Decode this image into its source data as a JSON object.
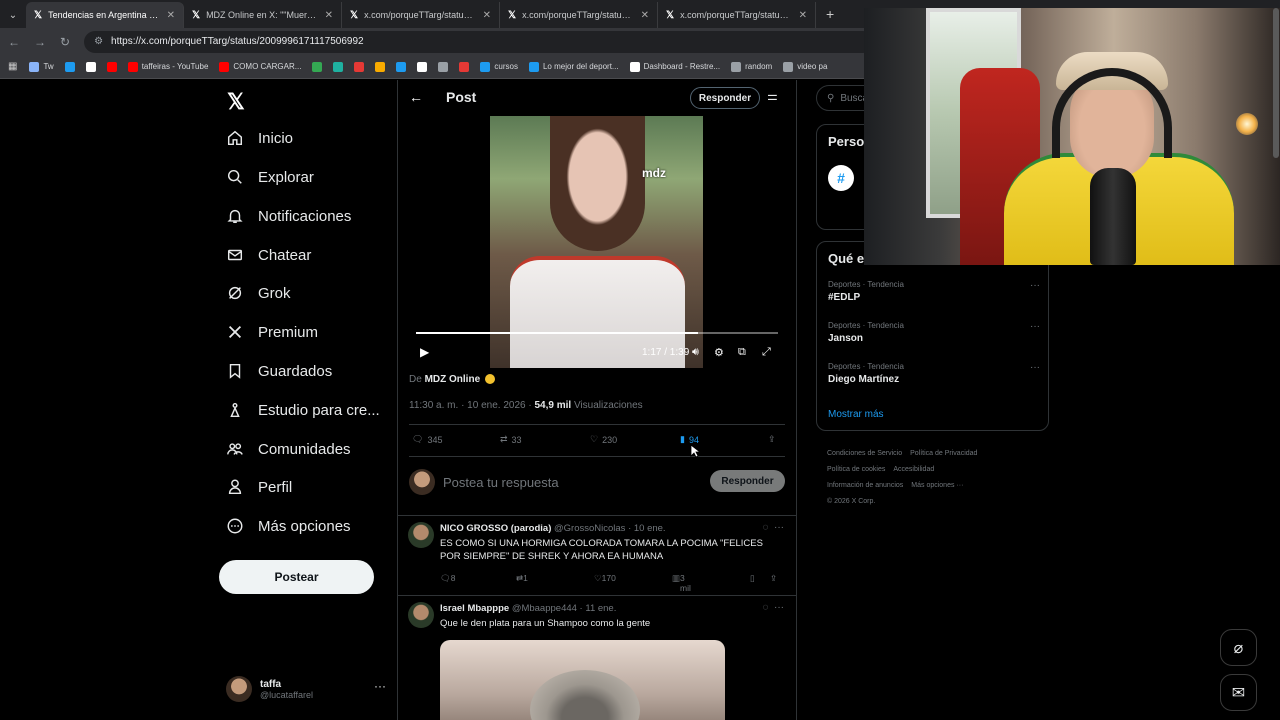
{
  "browser": {
    "tabs": [
      {
        "title": "Tendencias en Argentina en X:",
        "active": true
      },
      {
        "title": "MDZ Online en X: \"\"Muere un",
        "active": false
      },
      {
        "title": "x.com/porqueTTarg/status/200",
        "active": false
      },
      {
        "title": "x.com/porqueTTarg/status/200",
        "active": false
      },
      {
        "title": "x.com/porqueTTarg/status/200",
        "active": false
      }
    ],
    "url": "https://x.com/porqueTTarg/status/2009996171117506992",
    "bookmarks": [
      {
        "label": "Tw",
        "color": "#8ab4f8"
      },
      {
        "label": "",
        "color": "#1d9bf0"
      },
      {
        "label": "",
        "color": "#ffffff"
      },
      {
        "label": "",
        "color": "#ff0000"
      },
      {
        "label": "taffeiras - YouTube",
        "color": "#ff0000"
      },
      {
        "label": "COMO CARGAR...",
        "color": "#ff0000"
      },
      {
        "label": "",
        "color": "#34a853"
      },
      {
        "label": "",
        "color": "#1fb1a0"
      },
      {
        "label": "",
        "color": "#e53935"
      },
      {
        "label": "",
        "color": "#f9ab00"
      },
      {
        "label": "",
        "color": "#1d9bf0"
      },
      {
        "label": "",
        "color": "#ffffff"
      },
      {
        "label": "",
        "color": "#9aa0a6"
      },
      {
        "label": "",
        "color": "#e53935"
      },
      {
        "label": "cursos",
        "color": "#1d9bf0"
      },
      {
        "label": "Lo mejor del deport...",
        "color": "#1d9bf0"
      },
      {
        "label": "Dashboard - Restre...",
        "color": "#ffffff"
      },
      {
        "label": "random",
        "color": "#9aa0a6"
      },
      {
        "label": "video pa",
        "color": "#9aa0a6"
      }
    ]
  },
  "nav": {
    "items": [
      {
        "label": "Inicio",
        "icon": "home-icon"
      },
      {
        "label": "Explorar",
        "icon": "search-icon"
      },
      {
        "label": "Notificaciones",
        "icon": "bell-icon"
      },
      {
        "label": "Chatear",
        "icon": "mail-icon"
      },
      {
        "label": "Grok",
        "icon": "grok-icon"
      },
      {
        "label": "Premium",
        "icon": "x-icon"
      },
      {
        "label": "Guardados",
        "icon": "bookmark-icon"
      },
      {
        "label": "Estudio para cre...",
        "icon": "studio-icon"
      },
      {
        "label": "Comunidades",
        "icon": "communities-icon"
      },
      {
        "label": "Perfil",
        "icon": "person-icon"
      },
      {
        "label": "Más opciones",
        "icon": "more-icon"
      }
    ],
    "post_button": "Postear",
    "account": {
      "name": "taffa",
      "handle": "@lucataffarel"
    }
  },
  "post": {
    "header_title": "Post",
    "reply_button": "Responder",
    "video": {
      "logo": "mdz",
      "time": "1:17 / 1:39",
      "progress": 0.78
    },
    "author_prefix": "De",
    "author": "MDZ Online",
    "timestamp": "11:30 a. m. · 10 ene. 2026 ·",
    "views": "54,9 mil",
    "views_label": "Visualizaciones",
    "stats": {
      "replies": "345",
      "reposts": "33",
      "likes": "230",
      "bookmarks": "94"
    },
    "compose_placeholder": "Postea tu respuesta",
    "compose_button": "Responder"
  },
  "replies": [
    {
      "name": "NICO GROSSO (parodia)",
      "handle": "@GrossoNicolas · 10 ene.",
      "text": "ES COMO SI UNA HORMIGA COLORADA TOMARA LA POCIMA \"FELICES POR SIEMPRE\" DE SHREK Y AHORA EA HUMANA",
      "replies": "8",
      "reposts": "1",
      "likes": "170",
      "views": "3 mil"
    },
    {
      "name": "Israel Mbapppe",
      "handle": "@Mbaappe444 · 11 ene.",
      "text": "Que le den plata para un Shampoo como la gente"
    }
  ],
  "sidebar": {
    "search_placeholder": "Busca",
    "widget1_title": "Perso",
    "trends_title": "Qué e",
    "trends": [
      {
        "category": "Deportes · Tendencia",
        "name": "#EDLP"
      },
      {
        "category": "Deportes · Tendencia",
        "name": "Janson"
      },
      {
        "category": "Deportes · Tendencia",
        "name": "Diego Martínez"
      }
    ],
    "show_more": "Mostrar más",
    "footer": [
      "Condiciones de Servicio",
      "Política de Privacidad",
      "Política de cookies",
      "Accesibilidad",
      "Información de anuncios",
      "Más opciones ···",
      "© 2026 X Corp."
    ]
  }
}
